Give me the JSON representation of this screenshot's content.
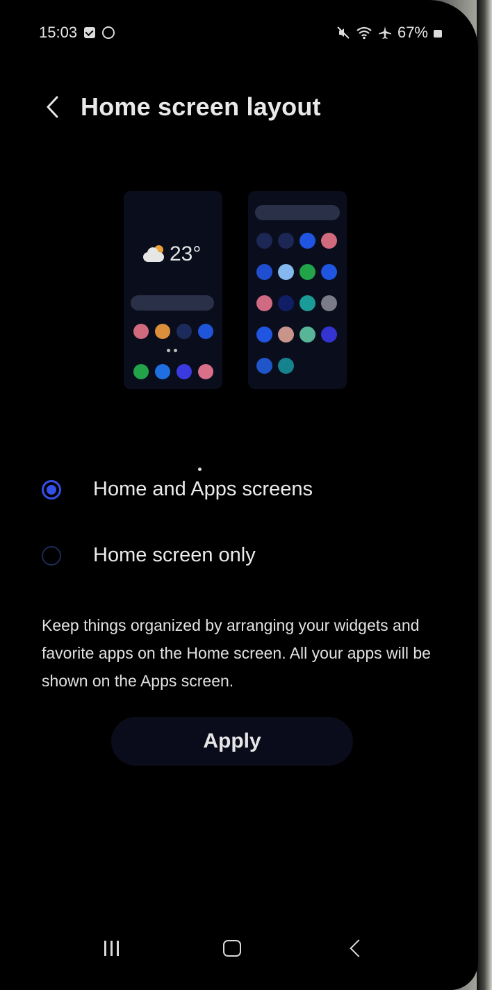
{
  "status_bar": {
    "time": "15:03",
    "battery": "67%",
    "icons": [
      "check-icon",
      "circle-icon",
      "mute-icon",
      "wifi-icon",
      "airplane-icon",
      "battery-icon"
    ]
  },
  "header": {
    "back_icon": "chevron-left-icon",
    "title": "Home screen layout"
  },
  "preview": {
    "home": {
      "temperature": "23°",
      "row1_colors": [
        "#d26a7d",
        "#db8f3a",
        "#1d2b5c",
        "#1f55d9"
      ],
      "row2_colors": [
        "#22a34a",
        "#1f6fe0",
        "#3a3ae0",
        "#d9708a"
      ]
    },
    "apps": {
      "rows": [
        [
          "#1c2756",
          "#1c2756",
          "#1f55e0",
          "#d26a7d"
        ],
        [
          "#1f4fd0",
          "#84b8ee",
          "#22a34a",
          "#1f55e0"
        ],
        [
          "#d06a82",
          "#101e66",
          "#1a9b98",
          "#7a7a88"
        ],
        [
          "#1f55e0",
          "#c9948a",
          "#58b598",
          "#3434d0"
        ],
        [
          "#1f55c8",
          "#14838d"
        ]
      ]
    }
  },
  "options": [
    {
      "label": "Home and Apps screens",
      "selected": true
    },
    {
      "label": "Home screen only",
      "selected": false
    }
  ],
  "description": "Keep things organized by arranging your widgets and favorite apps on the Home screen. All your apps will be shown on the Apps screen.",
  "apply_label": "Apply",
  "accent_color": "#3350e8",
  "nav_bar": {
    "icons": [
      "recents-icon",
      "home-icon",
      "back-icon"
    ]
  }
}
